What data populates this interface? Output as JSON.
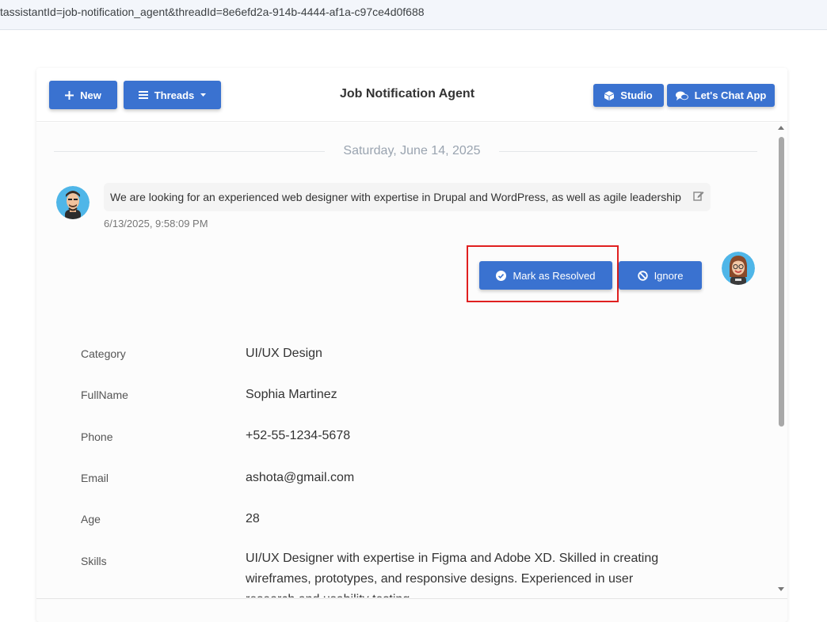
{
  "browser": {
    "url": "tassistantId=job-notification_agent&threadId=8e6efd2a-914b-4444-af1a-c97ce4d0f688"
  },
  "header": {
    "new_label": "New",
    "threads_label": "Threads",
    "title": "Job Notification Agent",
    "studio_label": "Studio",
    "chat_app_label": "Let's Chat App"
  },
  "chat": {
    "date_divider": "Saturday, June 14, 2025",
    "user_message": "We are looking for an experienced web designer with expertise in Drupal and WordPress, as well as agile leadership",
    "user_timestamp": "6/13/2025, 9:58:09 PM",
    "actions": {
      "resolve_label": "Mark as Resolved",
      "ignore_label": "Ignore"
    }
  },
  "details": [
    {
      "label": "Category",
      "value": "UI/UX Design"
    },
    {
      "label": "FullName",
      "value": "Sophia Martinez"
    },
    {
      "label": "Phone",
      "value": "+52-55-1234-5678"
    },
    {
      "label": "Email",
      "value": "ashota@gmail.com"
    },
    {
      "label": "Age",
      "value": "28"
    },
    {
      "label": "Skills",
      "value": "UI/UX Designer with expertise in Figma and Adobe XD. Skilled in creating wireframes, prototypes, and responsive designs. Experienced in user research and usability testing."
    }
  ],
  "colors": {
    "primary": "#3a72d0",
    "highlight": "#e02020"
  }
}
